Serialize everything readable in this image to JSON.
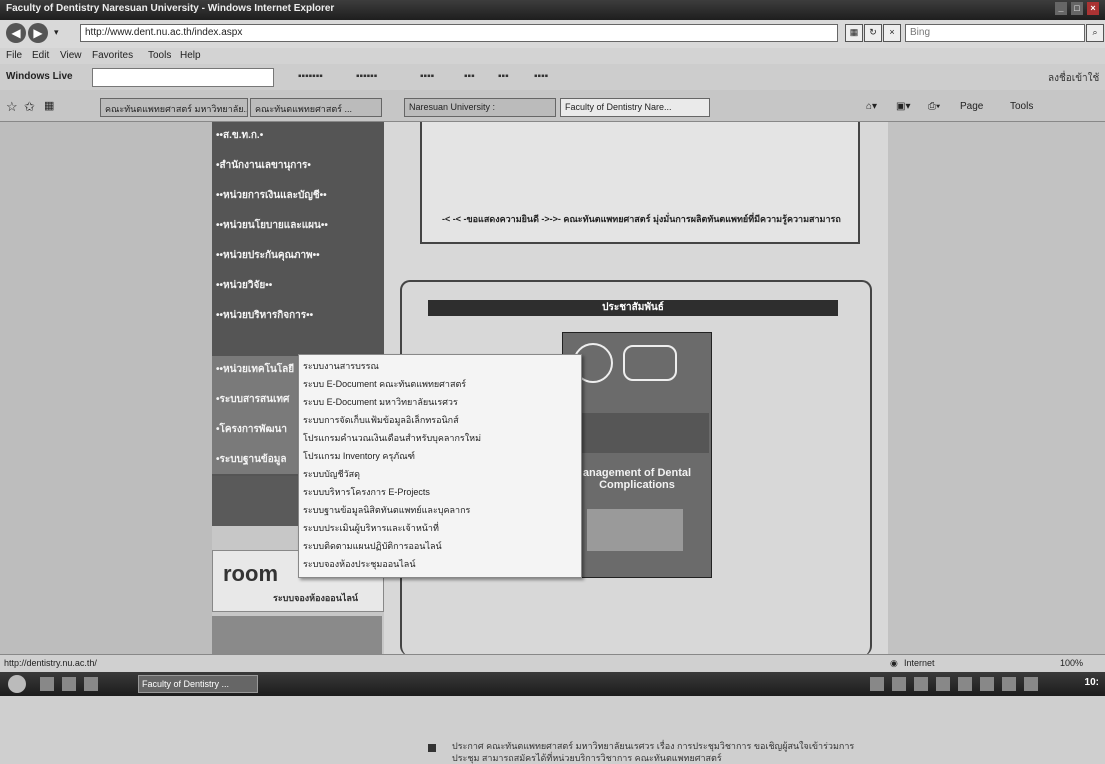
{
  "window": {
    "title": "Faculty of Dentistry Naresuan University - Windows Internet Explorer",
    "controls": [
      "_",
      "□",
      "×"
    ]
  },
  "address_bar": {
    "url": "http://www.dent.nu.ac.th/index.aspx",
    "search_placeholder": "Bing"
  },
  "menu": [
    "File",
    "Edit",
    "View",
    "Favorites",
    "Tools",
    "Help"
  ],
  "links_bar": {
    "windows_live": "Windows Live",
    "sign_in": "ลงชื่อเข้าใช้"
  },
  "tabs": [
    {
      "label": "คณะทันตแพทยศาสตร์ มหาวิทยาลัย...",
      "active": false
    },
    {
      "label": "คณะทันตแพทยศาสตร์ ...",
      "active": false
    },
    {
      "label": "Naresuan University :",
      "active": false
    },
    {
      "label": "Faculty of Dentistry Nare...",
      "active": true
    }
  ],
  "command_bar": {
    "page": "Page",
    "tools": "Tools"
  },
  "sidebar": {
    "items": [
      {
        "label": "••ส.ข.ท.ก.•"
      },
      {
        "label": "•สำนักงานเลขานุการ•"
      },
      {
        "label": "••หน่วยการเงินและบัญชี••"
      },
      {
        "label": "••หน่วยนโยบายและแผน••"
      },
      {
        "label": "••หน่วยประกันคุณภาพ••"
      },
      {
        "label": "••หน่วยวิจัย••"
      },
      {
        "label": "••หน่วยบริหารกิจการ••"
      },
      {
        "label": "••หน่วยเทคโนโลยี"
      },
      {
        "label": "•ระบบสารสนเทศ"
      },
      {
        "label": "•โครงการพัฒนา"
      },
      {
        "label": "•ระบบฐานข้อมูล"
      }
    ],
    "banner_room_text": "room",
    "banner_room_sub": "ระบบจองห้องออนไลน์"
  },
  "dropdown": {
    "items": [
      "ระบบงานสารบรรณ",
      "ระบบ E-Document คณะทันตแพทยศาสตร์",
      "ระบบ E-Document มหาวิทยาลัยนเรศวร",
      "ระบบการจัดเก็บแฟ้มข้อมูลอิเล็กทรอนิกส์",
      "โปรแกรมคำนวณเงินเดือนสำหรับบุคลากรใหม่",
      "โปรแกรม Inventory ครุภัณฑ์",
      "ระบบบัญชีวัสดุ",
      "ระบบบริหารโครงการ E-Projects",
      "ระบบฐานข้อมูลนิสิตทันตแพทย์และบุคลากร",
      "ระบบประเมินผู้บริหารและเจ้าหน้าที่",
      "ระบบติดตามแผนปฏิบัติการออนไลน์",
      "ระบบจองห้องประชุมออนไลน์"
    ]
  },
  "marquee": {
    "text": "-< -< -ขอแสดงความยินดี ->->- คณะทันตแพทยศาสตร์ มุ่งมั่นการผลิตทันตแพทย์ที่มีความรู้ความสามารถ"
  },
  "publicity": {
    "header": "ประชาสัมพันธ์",
    "poster_title": "anagement of Dental Complications",
    "news_text": "ประกาศ คณะทันตแพทยศาสตร์ มหาวิทยาลัยนเรศวร เรื่อง การประชุมวิชาการ ขอเชิญผู้สนใจเข้าร่วมการประชุม สามารถสมัครได้ที่หน่วยบริการวิชาการ คณะทันตแพทยศาสตร์"
  },
  "status": {
    "url": "http://dentistry.nu.ac.th/",
    "zone": "Internet",
    "zoom": "100%"
  },
  "taskbar": {
    "task_label": "Faculty of Dentistry ...",
    "clock": "10:"
  },
  "colors": {
    "nav_bg": "#555555",
    "header_bg": "#2e2e2e"
  }
}
